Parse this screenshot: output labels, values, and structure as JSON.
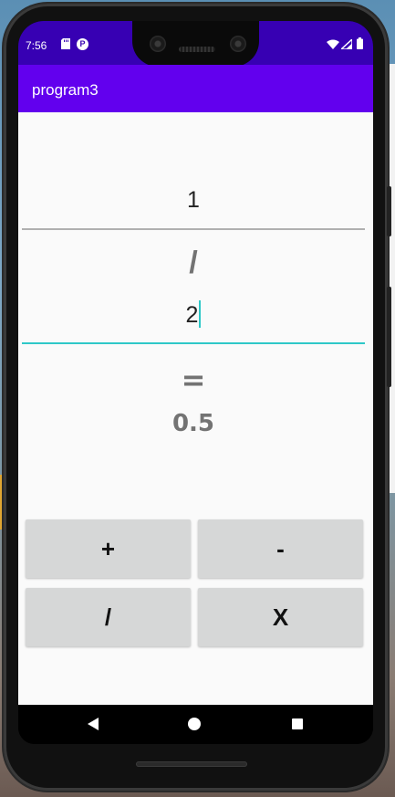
{
  "status_bar": {
    "time": "7:56",
    "icons": [
      "sd-card-icon",
      "p-icon",
      "wifi-icon",
      "signal-icon",
      "battery-icon"
    ],
    "p_glyph": "P"
  },
  "app_bar": {
    "title": "program3",
    "color": "#6200ee"
  },
  "calculator": {
    "first_value": "1",
    "operator_symbol": "/",
    "second_value": "2",
    "equals_symbol": "=",
    "result": "0.5"
  },
  "buttons": {
    "add_label": "+",
    "subtract_label": "-",
    "divide_label": "/",
    "multiply_label": "X"
  },
  "colors": {
    "status_bar": "#3700b3",
    "accent": "#2ec8c8",
    "button_bg": "#d6d7d7",
    "muted_text": "#737373"
  }
}
